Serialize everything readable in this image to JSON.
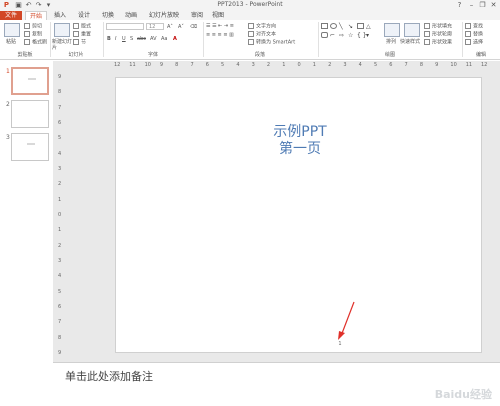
{
  "window": {
    "title": "PPT2013 - PowerPoint",
    "help": "?",
    "minimize": "–",
    "restore": "❐",
    "close": "✕"
  },
  "quick_access": [
    "save-icon",
    "undo-icon",
    "redo-icon",
    "customize-icon"
  ],
  "tabs": [
    "文件",
    "开始",
    "插入",
    "设计",
    "切换",
    "动画",
    "幻灯片放映",
    "审阅",
    "视图"
  ],
  "ribbon": {
    "clipboard": {
      "paste": "粘贴",
      "cut": "剪切",
      "copy": "复制",
      "format_painter": "格式刷",
      "label": "剪贴板"
    },
    "slides": {
      "new_slide": "新建幻灯片",
      "layout": "版式",
      "reset": "重置",
      "section": "节",
      "label": "幻灯片"
    },
    "font": {
      "size": "12",
      "bold": "B",
      "italic": "I",
      "underline": "U",
      "strike": "S",
      "abc": "abc",
      "spacing": "AV",
      "case": "Aa",
      "color": "A",
      "label": "字体"
    },
    "paragraph": {
      "text_direction": "文字方向",
      "align_text": "对齐文本",
      "convert_smartart": "转换为 SmartArt",
      "label": "段落"
    },
    "drawing": {
      "arrange": "排列",
      "quick_styles": "快速样式",
      "shape_fill": "形状填充",
      "shape_outline": "形状轮廓",
      "shape_effects": "形状效果",
      "label": "绘图"
    },
    "editing": {
      "find": "查找",
      "replace": "替换",
      "select": "选择",
      "label": "编辑"
    }
  },
  "ruler_h": [
    "12",
    "11",
    "10",
    "9",
    "8",
    "7",
    "6",
    "5",
    "4",
    "3",
    "2",
    "1",
    "0",
    "1",
    "2",
    "3",
    "4",
    "5",
    "6",
    "7",
    "8",
    "9",
    "10",
    "11",
    "12"
  ],
  "ruler_v": [
    "9",
    "8",
    "7",
    "6",
    "5",
    "4",
    "3",
    "2",
    "1",
    "0",
    "1",
    "2",
    "3",
    "4",
    "5",
    "6",
    "7",
    "8",
    "9"
  ],
  "thumbnails": [
    "1",
    "2",
    "3"
  ],
  "slide": {
    "title_line1": "示例PPT",
    "title_line2": "第一页",
    "page_number": "1"
  },
  "notes_placeholder": "单击此处添加备注",
  "watermark": "Baidu经验"
}
